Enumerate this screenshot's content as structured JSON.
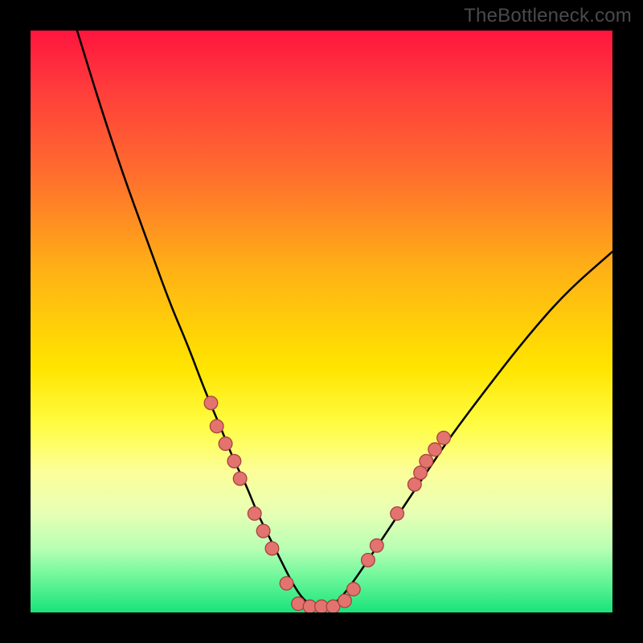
{
  "watermark": "TheBottleneck.com",
  "chart_data": {
    "type": "line",
    "title": "",
    "xlabel": "",
    "ylabel": "",
    "xlim": [
      0,
      100
    ],
    "ylim": [
      0,
      100
    ],
    "series": [
      {
        "name": "curve",
        "x": [
          8,
          12,
          16,
          20,
          24,
          27,
          30,
          33,
          35,
          37,
          39,
          41,
          43,
          45,
          47,
          49,
          51,
          53,
          56,
          60,
          64,
          68,
          72,
          78,
          85,
          92,
          100
        ],
        "y": [
          100,
          87,
          75,
          64,
          53,
          46,
          38,
          31,
          26,
          22,
          17,
          13,
          9,
          5,
          2,
          1,
          1,
          2,
          6,
          12,
          18,
          24,
          30,
          38,
          47,
          55,
          62
        ]
      }
    ],
    "markers": [
      {
        "x": 31,
        "y": 36
      },
      {
        "x": 32,
        "y": 32
      },
      {
        "x": 33.5,
        "y": 29
      },
      {
        "x": 35,
        "y": 26
      },
      {
        "x": 36,
        "y": 23
      },
      {
        "x": 38.5,
        "y": 17
      },
      {
        "x": 40,
        "y": 14
      },
      {
        "x": 41.5,
        "y": 11
      },
      {
        "x": 44,
        "y": 5
      },
      {
        "x": 46,
        "y": 1.5
      },
      {
        "x": 48,
        "y": 1
      },
      {
        "x": 50,
        "y": 1
      },
      {
        "x": 52,
        "y": 1
      },
      {
        "x": 54,
        "y": 2
      },
      {
        "x": 55.5,
        "y": 4
      },
      {
        "x": 58,
        "y": 9
      },
      {
        "x": 59.5,
        "y": 11.5
      },
      {
        "x": 63,
        "y": 17
      },
      {
        "x": 66,
        "y": 22
      },
      {
        "x": 67,
        "y": 24
      },
      {
        "x": 68,
        "y": 26
      },
      {
        "x": 69.5,
        "y": 28
      },
      {
        "x": 71,
        "y": 30
      }
    ],
    "marker_color": "#e2736f",
    "marker_stroke": "#a8423e",
    "curve_color": "#000000",
    "gradient_stops": [
      {
        "offset": 0,
        "color": "#ff153e"
      },
      {
        "offset": 10,
        "color": "#ff3c3c"
      },
      {
        "offset": 25,
        "color": "#ff6f2d"
      },
      {
        "offset": 42,
        "color": "#ffb414"
      },
      {
        "offset": 58,
        "color": "#ffe500"
      },
      {
        "offset": 68,
        "color": "#fffd45"
      },
      {
        "offset": 76,
        "color": "#fcfe9b"
      },
      {
        "offset": 83,
        "color": "#e6ffb4"
      },
      {
        "offset": 89,
        "color": "#b8ffb4"
      },
      {
        "offset": 94,
        "color": "#6cf79a"
      },
      {
        "offset": 100,
        "color": "#18e37a"
      }
    ]
  }
}
